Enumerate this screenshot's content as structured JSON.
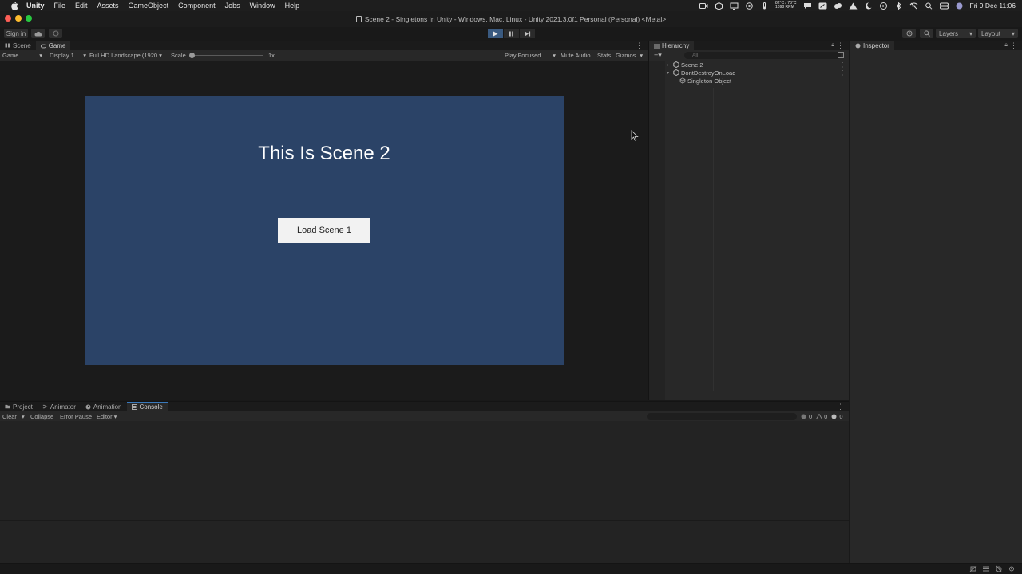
{
  "menubar": {
    "items": [
      "Unity",
      "File",
      "Edit",
      "Assets",
      "GameObject",
      "Component",
      "Jobs",
      "Window",
      "Help"
    ],
    "temp_line1": "82°C / 73°C",
    "temp_line2": "1098 RPM",
    "clock": "Fri 9 Dec  11:06"
  },
  "window": {
    "title": "Scene 2 - Singletons In Unity - Windows, Mac, Linux - Unity 2021.3.0f1 Personal (Personal) <Metal>"
  },
  "toolbar": {
    "sign_in": "Sign in",
    "layers": "Layers",
    "layout": "Layout"
  },
  "game_panel": {
    "tabs": [
      {
        "label": "Scene",
        "active": false
      },
      {
        "label": "Game",
        "active": true
      }
    ],
    "bar": {
      "mode": "Game",
      "display": "Display 1",
      "resolution": "Full HD Landscape (1920",
      "scale_label": "Scale",
      "scale_value": "1x",
      "play_focused": "Play Focused",
      "mute_audio": "Mute Audio",
      "stats": "Stats",
      "gizmos": "Gizmos"
    },
    "view": {
      "background": "#2b4367",
      "heading": "This Is Scene 2",
      "button_label": "Load Scene 1"
    }
  },
  "hierarchy": {
    "tab": "Hierarchy",
    "search_placeholder": "All",
    "items": [
      {
        "label": "Scene 2",
        "depth": 0
      },
      {
        "label": "DontDestroyOnLoad",
        "depth": 0
      },
      {
        "label": "Singleton Object",
        "depth": 1
      }
    ]
  },
  "inspector": {
    "tab": "Inspector"
  },
  "bottom_panel": {
    "tabs": [
      {
        "label": "Project",
        "active": false
      },
      {
        "label": "Animator",
        "active": false
      },
      {
        "label": "Animation",
        "active": false
      },
      {
        "label": "Console",
        "active": true
      }
    ],
    "bar": {
      "clear": "Clear",
      "collapse": "Collapse",
      "error_pause": "Error Pause",
      "editor": "Editor"
    },
    "counts": {
      "logs": "0",
      "warnings": "0",
      "errors": "0"
    }
  },
  "colors": {
    "accent": "#3a79bb",
    "play_active": "#3a5a80"
  }
}
